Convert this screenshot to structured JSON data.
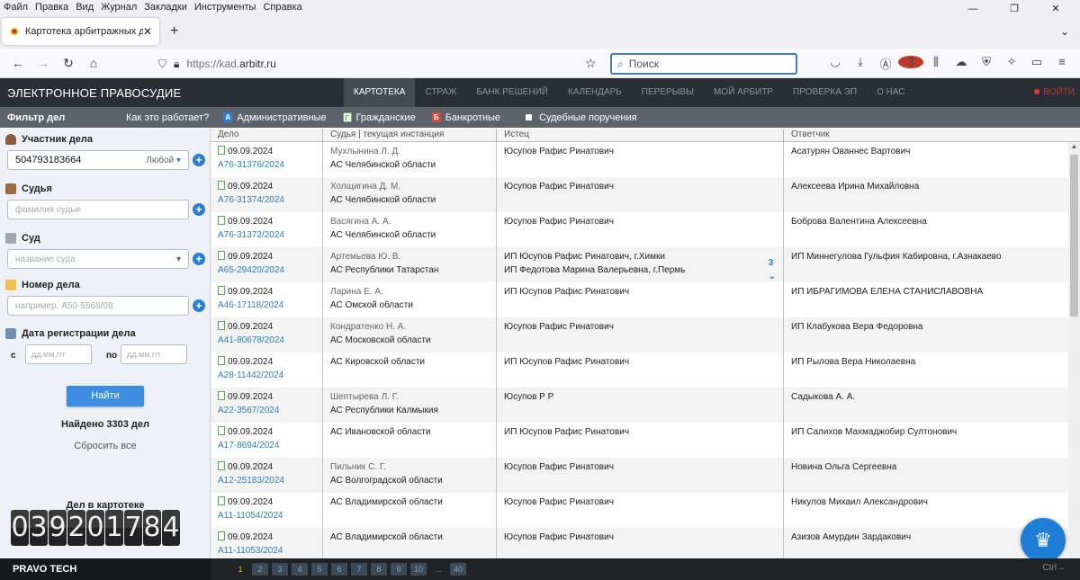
{
  "browser": {
    "menu": [
      "Файл",
      "Правка",
      "Вид",
      "Журнал",
      "Закладки",
      "Инструменты",
      "Справка"
    ],
    "tab_title": "Картотека арбитражных дел",
    "url_prefix": "https://kad.",
    "url_domain": "arbitr.ru",
    "search_placeholder": "Поиск",
    "ext_badge": "3"
  },
  "site": {
    "brand": "ЭЛЕКТРОННОЕ ПРАВОСУДИЕ",
    "nav": [
      "КАРТОТЕКА",
      "СТРАЖ",
      "БАНК РЕШЕНИЙ",
      "КАЛЕНДАРЬ",
      "ПЕРЕРЫВЫ",
      "МОЙ АРБИТР",
      "ПРОВЕРКА ЭП",
      "О НАС"
    ],
    "logout": "ВОЙТИ"
  },
  "filterbar": {
    "title": "Фильтр дел",
    "how": "Как это работает?",
    "admin": "Административные",
    "civil": "Гражданские",
    "bankrupt": "Банкротные",
    "orders": "Судебные поручения"
  },
  "sidebar": {
    "participant_label": "Участник дела",
    "participant_value": "504793183664",
    "participant_any": "Любой",
    "judge_label": "Судья",
    "judge_placeholder": "фамилия судьи",
    "court_label": "Суд",
    "court_placeholder": "название суда",
    "case_label": "Номер дела",
    "case_placeholder": "например, А50-5568/08",
    "date_label": "Дата регистрации дела",
    "date_from": "с",
    "date_to": "по",
    "date_placeholder": "дд.мм.ггг",
    "find": "Найти",
    "found": "Найдено 3303 дел",
    "reset": "Сбросить все",
    "counter_label": "Дел в картотеке",
    "counter_digits": [
      "0",
      "3",
      "9",
      "2",
      "0",
      "1",
      "7",
      "8",
      "4"
    ]
  },
  "table": {
    "headers": [
      "Дело",
      "Судья | текущая инстанция",
      "Истец",
      "Ответчик"
    ],
    "rows": [
      {
        "date": "09.09.2024",
        "case": "А76-31376/2024",
        "judge": "Мухлынина Л. Д.",
        "court": "АС Челябинской области",
        "plaintiff": "Юсупов Рафис Ринатович",
        "plaintiff2": "",
        "defendant": "Асатурян Ованнес Вартович",
        "more": ""
      },
      {
        "date": "09.09.2024",
        "case": "А76-31374/2024",
        "judge": "Холщигина Д. М.",
        "court": "АС Челябинской области",
        "plaintiff": "Юсупов Рафис Ринатович",
        "plaintiff2": "",
        "defendant": "Алексеева Ирина Михайловна",
        "more": ""
      },
      {
        "date": "09.09.2024",
        "case": "А76-31372/2024",
        "judge": "Васягина А. А.",
        "court": "АС Челябинской области",
        "plaintiff": "Юсупов Рафис Ринатович",
        "plaintiff2": "",
        "defendant": "Боброва Валентина Алексеевна",
        "more": ""
      },
      {
        "date": "09.09.2024",
        "case": "А65-29420/2024",
        "judge": "Артемьева Ю. В.",
        "court": "АС Республики Татарстан",
        "plaintiff": "ИП Юсупов Рафис Ринатович, г.Химки",
        "plaintiff2": "ИП Федотова Марина Валерьевна, г.Пермь",
        "defendant": "ИП Миннегулова Гульфия Кабировна, г.Азнакаево",
        "more": "3"
      },
      {
        "date": "09.09.2024",
        "case": "А46-17118/2024",
        "judge": "Ларина Е. А.",
        "court": "АС Омской области",
        "plaintiff": "ИП Юсупов Рафис Ринатович",
        "plaintiff2": "",
        "defendant": "ИП ИБРАГИМОВА ЕЛЕНА СТАНИСЛАВОВНА",
        "more": ""
      },
      {
        "date": "09.09.2024",
        "case": "А41-80678/2024",
        "judge": "Кондратенко Н. А.",
        "court": "АС Московской области",
        "plaintiff": "Юсупов Рафис Ринатович",
        "plaintiff2": "",
        "defendant": "ИП Клабукова Вера Федоровна",
        "more": ""
      },
      {
        "date": "09.09.2024",
        "case": "А28-11442/2024",
        "judge": "",
        "court": "АС Кировской области",
        "plaintiff": "ИП Юсупов Рафис Ринатович",
        "plaintiff2": "",
        "defendant": "ИП Рылова Вера Николаевна",
        "more": ""
      },
      {
        "date": "09.09.2024",
        "case": "А22-3567/2024",
        "judge": "Шептырева Л. Г.",
        "court": "АС Республики Калмыкия",
        "plaintiff": "Юсупов Р Р",
        "plaintiff2": "",
        "defendant": "Садыкова А. А.",
        "more": ""
      },
      {
        "date": "09.09.2024",
        "case": "А17-8694/2024",
        "judge": "",
        "court": "АС Ивановской области",
        "plaintiff": "ИП Юсупов Рафис Ринатович",
        "plaintiff2": "",
        "defendant": "ИП Салихов Махмаджобир Султонович",
        "more": ""
      },
      {
        "date": "09.09.2024",
        "case": "А12-25183/2024",
        "judge": "Пильник С. Г.",
        "court": "АС Волгоградской области",
        "plaintiff": "Юсупов Рафис Ринатович",
        "plaintiff2": "",
        "defendant": "Новина Ольга Сергеевна",
        "more": ""
      },
      {
        "date": "09.09.2024",
        "case": "А11-11054/2024",
        "judge": "",
        "court": "АС Владимирской области",
        "plaintiff": "Юсупов Рафис Ринатович",
        "plaintiff2": "",
        "defendant": "Никулов Михаил Александрович",
        "more": ""
      },
      {
        "date": "09.09.2024",
        "case": "А11-11053/2024",
        "judge": "",
        "court": "АС Владимирской области",
        "plaintiff": "Юсупов Рафис Ринатович",
        "plaintiff2": "",
        "defendant": "Азизов Амурдин Зардакович",
        "more": ""
      }
    ]
  },
  "footer": {
    "brand": "PRAVO TECH",
    "pages": [
      "1",
      "2",
      "3",
      "4",
      "5",
      "6",
      "7",
      "8",
      "9",
      "10",
      "...",
      "40"
    ],
    "current_page": "1",
    "shortcut": "Ctrl→"
  }
}
